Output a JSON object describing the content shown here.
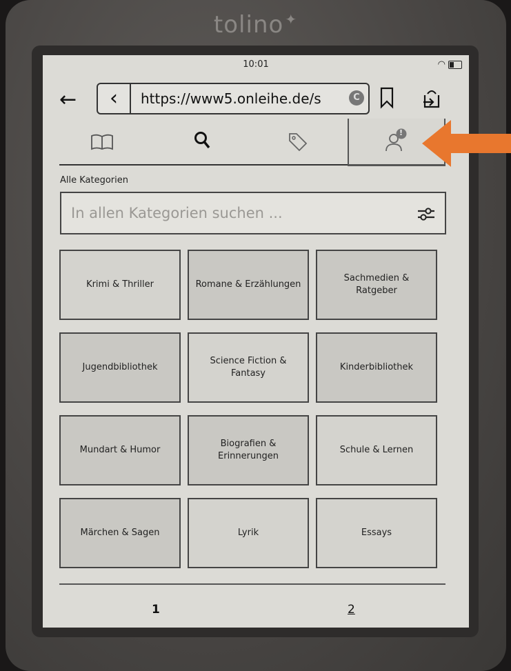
{
  "device": {
    "brand": "tolino"
  },
  "status": {
    "time": "10:01"
  },
  "browser": {
    "url": "https://www5.onleihe.de/s",
    "reload_glyph": "C"
  },
  "tabs": [
    {
      "name": "book-icon"
    },
    {
      "name": "search-icon"
    },
    {
      "name": "tag-icon"
    },
    {
      "name": "user-icon",
      "badge": "!",
      "active": true
    }
  ],
  "content": {
    "category_label": "Alle Kategorien",
    "search_placeholder": "In allen Kategorien suchen ...",
    "categories": [
      {
        "label": "Krimi & Thriller"
      },
      {
        "label": "Romane & Erzählungen"
      },
      {
        "label": "Sachmedien & Ratgeber"
      },
      {
        "label": "Jugendbibliothek"
      },
      {
        "label": "Science Fiction & Fantasy"
      },
      {
        "label": "Kinderbibliothek"
      },
      {
        "label": "Mundart & Humor"
      },
      {
        "label": "Biografien & Erinnerungen"
      },
      {
        "label": "Schule & Lernen"
      },
      {
        "label": "Märchen & Sagen"
      },
      {
        "label": "Lyrik"
      },
      {
        "label": "Essays"
      }
    ]
  },
  "pagination": {
    "page1": "1",
    "page2": "2"
  },
  "colors": {
    "screen": "#dcdbd6",
    "tile": "#c9c8c3",
    "arrow": "#e8772e",
    "bezel": "#2e2c2b"
  }
}
